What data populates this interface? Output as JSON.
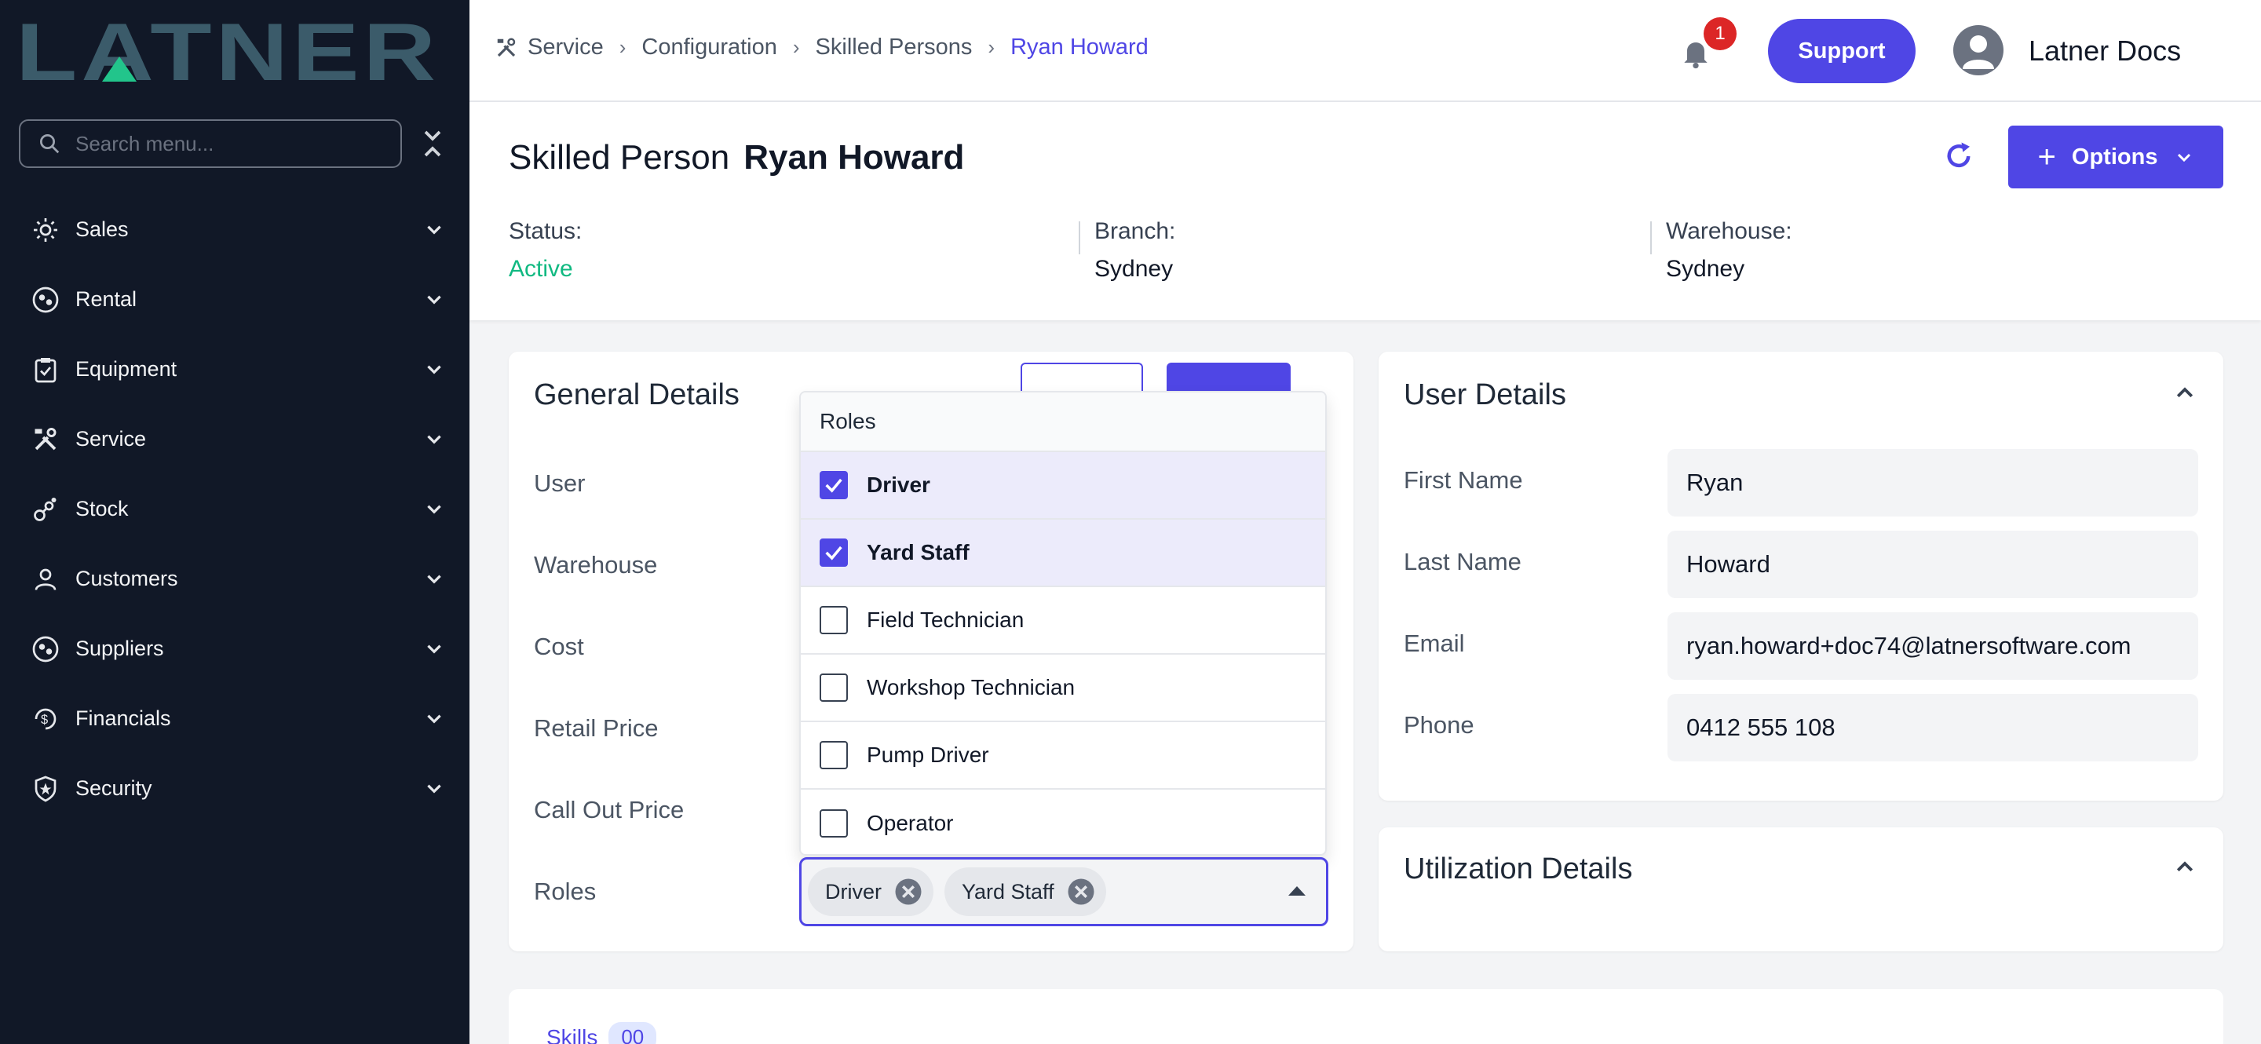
{
  "brand": {
    "logo_text": "LATNER"
  },
  "sidebar": {
    "search_placeholder": "Search menu...",
    "items": [
      {
        "label": "Sales",
        "icon": "sales-icon"
      },
      {
        "label": "Rental",
        "icon": "rental-icon"
      },
      {
        "label": "Equipment",
        "icon": "clipboard-icon"
      },
      {
        "label": "Service",
        "icon": "tools-icon"
      },
      {
        "label": "Stock",
        "icon": "stock-icon"
      },
      {
        "label": "Customers",
        "icon": "user-icon"
      },
      {
        "label": "Suppliers",
        "icon": "supplier-icon"
      },
      {
        "label": "Financials",
        "icon": "dollar-icon"
      },
      {
        "label": "Security",
        "icon": "shield-icon"
      }
    ]
  },
  "topbar": {
    "breadcrumbs": [
      "Service",
      "Configuration",
      "Skilled Persons",
      "Ryan Howard"
    ],
    "notification_count": "1",
    "support_label": "Support",
    "account_label": "Latner Docs"
  },
  "header": {
    "title_prefix": "Skilled Person",
    "title_name": "Ryan Howard",
    "options_label": "Options",
    "status_label": "Status:",
    "status_value": "Active",
    "branch_label": "Branch:",
    "branch_value": "Sydney",
    "warehouse_label": "Warehouse:",
    "warehouse_value": "Sydney"
  },
  "general": {
    "title": "General Details",
    "rows": [
      "User",
      "Warehouse",
      "Cost",
      "Retail Price",
      "Call Out Price",
      "Roles"
    ],
    "roles_dropdown": {
      "header": "Roles",
      "options": [
        {
          "label": "Driver",
          "checked": true
        },
        {
          "label": "Yard Staff",
          "checked": true
        },
        {
          "label": "Field Technician",
          "checked": false
        },
        {
          "label": "Workshop Technician",
          "checked": false
        },
        {
          "label": "Pump Driver",
          "checked": false
        },
        {
          "label": "Operator",
          "checked": false
        }
      ]
    },
    "selected_roles": [
      "Driver",
      "Yard Staff"
    ]
  },
  "user_details": {
    "title": "User Details",
    "first_name_label": "First Name",
    "first_name": "Ryan",
    "last_name_label": "Last Name",
    "last_name": "Howard",
    "email_label": "Email",
    "email": "ryan.howard+doc74@latnersoftware.com",
    "phone_label": "Phone",
    "phone": "0412 555 108"
  },
  "utilization": {
    "title": "Utilization Details"
  },
  "skills": {
    "tab_label": "Skills",
    "count": "00"
  },
  "colors": {
    "accent": "#4f46e5",
    "sidebar_bg": "#111827",
    "status_active": "#10b981",
    "badge": "#dc2626",
    "logo": "#3b5b6a"
  }
}
